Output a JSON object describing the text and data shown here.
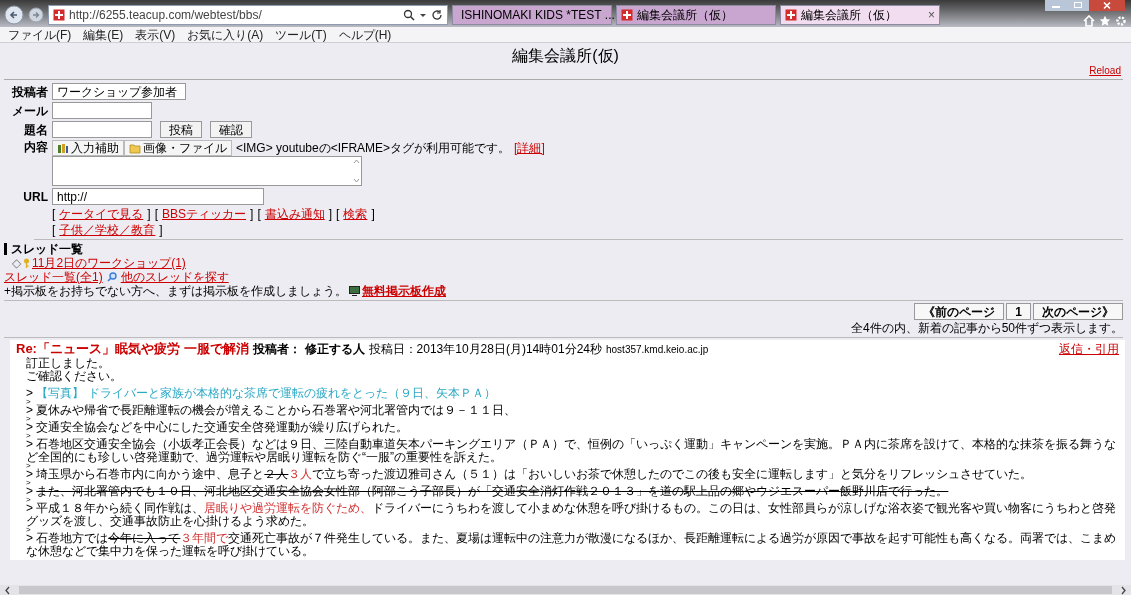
{
  "browser": {
    "address": "http://6255.teacup.com/webtest/bbs/",
    "tabs": [
      {
        "title": "ISHINOMAKI KIDS *TEST ...",
        "kind": "ie",
        "selected": false
      },
      {
        "title": "編集会議所（仮）",
        "kind": "teacup",
        "selected": false
      },
      {
        "title": "編集会議所（仮）",
        "kind": "teacup",
        "selected": true
      }
    ],
    "close_tab": "×"
  },
  "menu": [
    "ファイル(F)",
    "編集(E)",
    "表示(V)",
    "お気に入り(A)",
    "ツール(T)",
    "ヘルプ(H)"
  ],
  "page": {
    "title": "編集会議所(仮)",
    "reload": "Reload"
  },
  "form": {
    "fields": [
      {
        "label": "投稿者",
        "value": "ワークショップ参加者"
      },
      {
        "label": "メール"
      },
      {
        "label": "題名",
        "buttons": [
          "投稿",
          "確認"
        ]
      }
    ],
    "content_label": "内容",
    "tools": [
      {
        "label": "入力補助",
        "kind": "books"
      },
      {
        "label": "画像・ファイル",
        "kind": "folder"
      }
    ],
    "hint": "<IMG> youtubeの<IFRAME>タグが利用可能です。",
    "hint_link": "[詳細]",
    "url_label": "URL",
    "url_value": "http://",
    "link_rows": [
      [
        {
          "open": "[",
          "text": "ケータイで見る",
          "close": "]"
        },
        {
          "open": "[",
          "text": "BBSティッカー",
          "close": "]"
        },
        {
          "open": "[",
          "text": "書込み通知",
          "close": "]"
        },
        {
          "open": "[",
          "text": "検索",
          "close": "]"
        }
      ],
      [
        {
          "open": "[",
          "text": "子供／学校／教育",
          "close": "]"
        }
      ]
    ]
  },
  "threads": {
    "heading": "スレッド一覧",
    "items": [
      {
        "bullet": "◇",
        "title": "11月2日のワークショップ(1)"
      }
    ],
    "all_link": "スレッド一覧(全1)",
    "search_link": "他のスレッドを探す",
    "promo": "+掲示板をお持ちでない方へ、まずは掲示板を作成しましょう。",
    "promo_link": "無料掲示板作成"
  },
  "pager": {
    "prev": "《前のページ",
    "pages": [
      "1"
    ],
    "next": "次のページ》",
    "summary": "全4件の内、新着の記事から50件ずつ表示します。"
  },
  "post": {
    "title": "Re:「ニュース」眠気や疲労 一服で解消",
    "author_label": "投稿者：",
    "author": "修正する人",
    "date": "投稿日：2013年10月28日(月)14時01分24秒",
    "host": "host357.kmd.keio.ac.jp",
    "reply": "返信・引用",
    "lines": [
      {
        "kind": "text",
        "segments": [
          {
            "text": "訂正しました。",
            "kind": "normal"
          }
        ]
      },
      {
        "kind": "text",
        "segments": [
          {
            "text": "ご確認ください。",
            "kind": "normal"
          }
        ]
      },
      {
        "kind": "blank"
      },
      {
        "kind": "text",
        "segments": [
          {
            "text": "> ",
            "kind": "normal"
          },
          {
            "text": "【写真】 ドライバーと家族が本格的な茶席で運転の疲れをとった（９日、矢本ＰＡ）",
            "kind": "caption"
          }
        ]
      },
      {
        "kind": "gap",
        "segments": [
          {
            "text": ">",
            "kind": "normal"
          }
        ]
      },
      {
        "kind": "text",
        "segments": [
          {
            "text": "> 夏休みや帰省で長距離運転の機会が増えることから石巻署や河北署管内では９－１１日、",
            "kind": "normal"
          }
        ]
      },
      {
        "kind": "gap",
        "segments": [
          {
            "text": ">",
            "kind": "normal"
          }
        ]
      },
      {
        "kind": "text",
        "segments": [
          {
            "text": "> 交通安全協会などを中心にした交通安全啓発運動が繰り広げられた。",
            "kind": "normal"
          }
        ]
      },
      {
        "kind": "gap",
        "segments": [
          {
            "text": ">",
            "kind": "normal"
          }
        ]
      },
      {
        "kind": "text",
        "segments": [
          {
            "text": "> 石巻地区交通安全協会（小坂孝正会長）などは９日、三陸自動車道矢本パーキングエリア（ＰＡ）で、恒例の「いっぷく運動」キャンペーンを実施。ＰＡ内に茶席を設けて、本格的な抹茶を振る舞うなど全国的にも珍しい啓発運動で、過労運転や居眠り運転を防ぐ“一服”の重要性を訴えた。",
            "kind": "normal"
          }
        ]
      },
      {
        "kind": "gap",
        "segments": [
          {
            "text": ">",
            "kind": "normal"
          }
        ]
      },
      {
        "kind": "text",
        "segments": [
          {
            "text": "> 埼玉県から石巻市内に向かう途中、息子と",
            "kind": "normal"
          },
          {
            "text": "２人",
            "kind": "deleted"
          },
          {
            "text": "３人",
            "kind": "inserted"
          },
          {
            "text": "で立ち寄った渡辺雅司さん（５１）は「おいしいお茶で休憩したのでこの後も安全に運転します」と気分をリフレッシュさせていた。",
            "kind": "normal"
          }
        ]
      },
      {
        "kind": "gap",
        "segments": [
          {
            "text": ">",
            "kind": "normal"
          }
        ]
      },
      {
        "kind": "text",
        "segments": [
          {
            "text": "> ",
            "kind": "normal"
          },
          {
            "text": "また、河北署管内でも１０日、河北地区交通安全協会女性部（阿部こう子部長）が「交通安全消灯作戦２０１３」を道の駅上品の郷やウジエスーパー飯野川店で行った。",
            "kind": "deleted"
          }
        ]
      },
      {
        "kind": "gap",
        "segments": [
          {
            "text": ">",
            "kind": "normal"
          }
        ]
      },
      {
        "kind": "text",
        "segments": [
          {
            "text": "> 平成１８年から続く同作戦は、",
            "kind": "normal"
          },
          {
            "text": "居眠りや過労運転を防ぐため、",
            "kind": "inserted"
          },
          {
            "text": "ドライバーにうちわを渡して小まめな休憩を呼び掛けるもの。この日は、女性部員らが涼しげな浴衣姿で観光客や買い物客にうちわと啓発グッズを渡し、交通事故防止を心掛けるよう求めた。",
            "kind": "normal"
          }
        ]
      },
      {
        "kind": "gap",
        "segments": [
          {
            "text": ">",
            "kind": "normal"
          }
        ]
      },
      {
        "kind": "text",
        "segments": [
          {
            "text": "> 石巻地方では",
            "kind": "normal"
          },
          {
            "text": "今年に入って",
            "kind": "deleted"
          },
          {
            "text": "３年間で",
            "kind": "inserted"
          },
          {
            "text": "交通死亡事故が７件発生している。また、夏場は運転中の注意力が散漫になるほか、長距離運転による過労が原因で事故を起す可能性も高くなる。両署では、こまめな休憩などで集中力を保った運転を呼び掛けている。",
            "kind": "normal"
          }
        ]
      }
    ]
  }
}
